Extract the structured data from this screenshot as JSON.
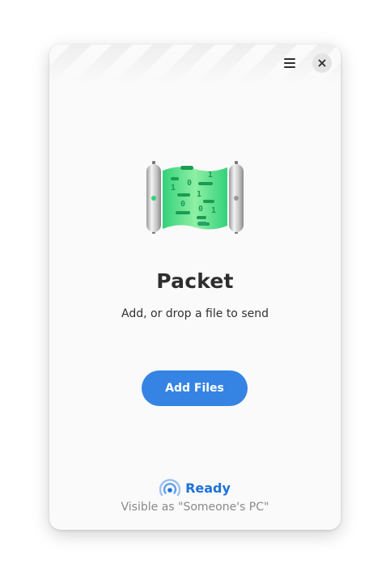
{
  "window": {
    "title": "Packet"
  },
  "header": {
    "menu_icon": "hamburger-menu-icon",
    "close_icon": "close-icon"
  },
  "main": {
    "illustration_icon": "packet-data-roller-icon",
    "title": "Packet",
    "subtitle": "Add, or drop a file to send",
    "add_files_label": "Add Files"
  },
  "status": {
    "icon": "broadcast-signal-icon",
    "text": "Ready",
    "visibility": "Visible as \"Someone's PC\""
  },
  "colors": {
    "accent": "#3584e4",
    "status_blue": "#1c71d8",
    "illustration_green": "#33d17a",
    "window_bg": "#fafafa"
  }
}
